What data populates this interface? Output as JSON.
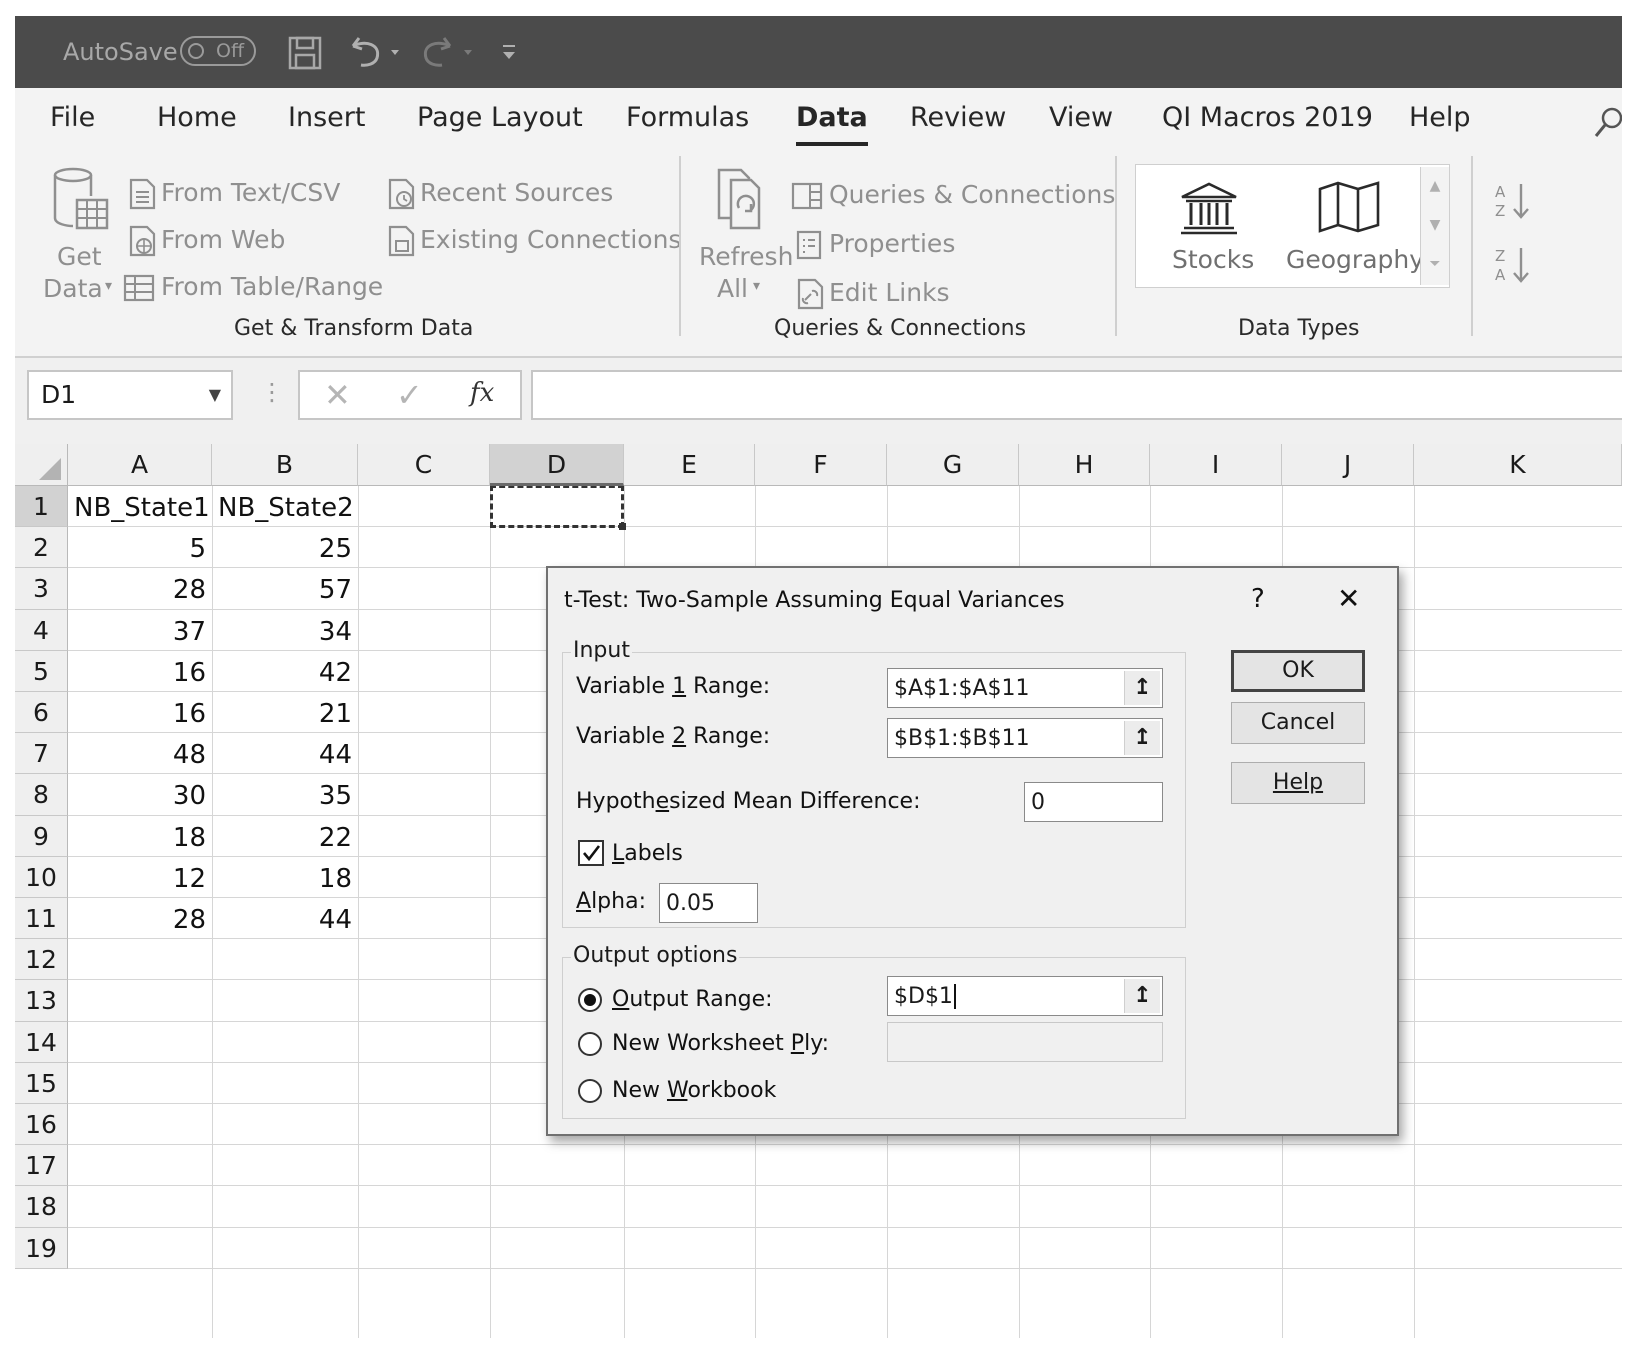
{
  "titlebar": {
    "autosave_label": "AutoSave",
    "autosave_state": "Off"
  },
  "tabs": [
    {
      "label": "File"
    },
    {
      "label": "Home"
    },
    {
      "label": "Insert"
    },
    {
      "label": "Page Layout"
    },
    {
      "label": "Formulas"
    },
    {
      "label": "Data",
      "active": true
    },
    {
      "label": "Review"
    },
    {
      "label": "View"
    },
    {
      "label": "QI Macros 2019"
    },
    {
      "label": "Help"
    }
  ],
  "ribbon": {
    "get_data": {
      "line1": "Get",
      "line2": "Data"
    },
    "from_text_csv": "From Text/CSV",
    "from_web": "From Web",
    "from_table_range": "From Table/Range",
    "recent_sources": "Recent Sources",
    "existing_connections": "Existing Connections",
    "group_get_transform": "Get & Transform Data",
    "refresh": {
      "line1": "Refresh",
      "line2": "All"
    },
    "queries_connections": "Queries & Connections",
    "properties": "Properties",
    "edit_links": "Edit Links",
    "group_queries": "Queries & Connections",
    "stocks": "Stocks",
    "geography": "Geography",
    "group_data_types": "Data Types"
  },
  "formula_bar": {
    "name_box": "D1",
    "fx": "fx",
    "formula": ""
  },
  "grid": {
    "columns": [
      "A",
      "B",
      "C",
      "D",
      "E",
      "F",
      "G",
      "H",
      "I",
      "J",
      "K"
    ],
    "selected_column": "D",
    "rows": [
      "1",
      "2",
      "3",
      "4",
      "5",
      "6",
      "7",
      "8",
      "9",
      "10",
      "11",
      "12",
      "13",
      "14",
      "15",
      "16",
      "17",
      "18",
      "19"
    ],
    "headers": {
      "A": "NB_State1",
      "B": "NB_State2"
    },
    "col_a": [
      "5",
      "28",
      "37",
      "16",
      "16",
      "48",
      "30",
      "18",
      "12",
      "28"
    ],
    "col_b": [
      "25",
      "57",
      "34",
      "42",
      "21",
      "44",
      "35",
      "22",
      "18",
      "44"
    ]
  },
  "dialog": {
    "title": "t-Test: Two-Sample Assuming Equal Variances",
    "help_glyph": "?",
    "close_glyph": "✕",
    "input_legend": "Input",
    "var1_label": "Variable 1 Range:",
    "var1_value": "$A$1:$A$11",
    "var2_label": "Variable 2 Range:",
    "var2_value": "$B$1:$B$11",
    "hmd_label": "Hypothesized Mean Difference:",
    "hmd_value": "0",
    "labels_label": "Labels",
    "labels_checked": true,
    "alpha_label": "Alpha:",
    "alpha_value": "0.05",
    "output_legend": "Output options",
    "output_range_label": "Output Range:",
    "output_range_value": "$D$1",
    "new_worksheet_label": "New Worksheet Ply:",
    "new_worksheet_value": "",
    "new_workbook_label": "New Workbook",
    "ok_label": "OK",
    "cancel_label": "Cancel",
    "help_label": "Help"
  }
}
